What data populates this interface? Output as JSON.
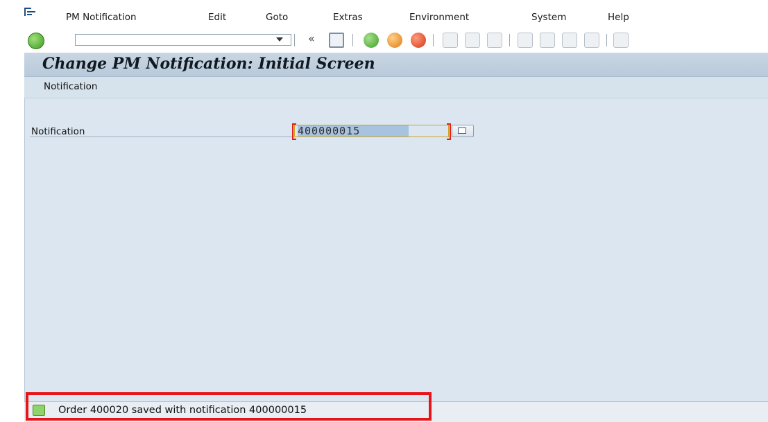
{
  "menubar": {
    "items": [
      "PM Notification",
      "Edit",
      "Goto",
      "Extras",
      "Environment",
      "System",
      "Help"
    ]
  },
  "toolbar": {
    "command_field_value": "",
    "icons": [
      "enter-icon",
      "save-icon",
      "back-icon",
      "exit-icon",
      "cancel-icon",
      "print-icon",
      "find-icon",
      "find-next-icon",
      "first-page-icon",
      "previous-page-icon",
      "next-page-icon",
      "last-page-icon",
      "layout-icon"
    ]
  },
  "page": {
    "title": "Change PM Notification: Initial Screen",
    "application_toolbar_label": "Notification"
  },
  "form": {
    "notification_label": "Notification",
    "notification_value": "400000015"
  },
  "status": {
    "message": "Order 400020 saved with notification 400000015",
    "type": "success"
  },
  "colors": {
    "highlight": "#e8141b",
    "title_bar": "#c9d6e3",
    "content_background": "#dbe6f0",
    "input_background": "#fff7a8"
  }
}
